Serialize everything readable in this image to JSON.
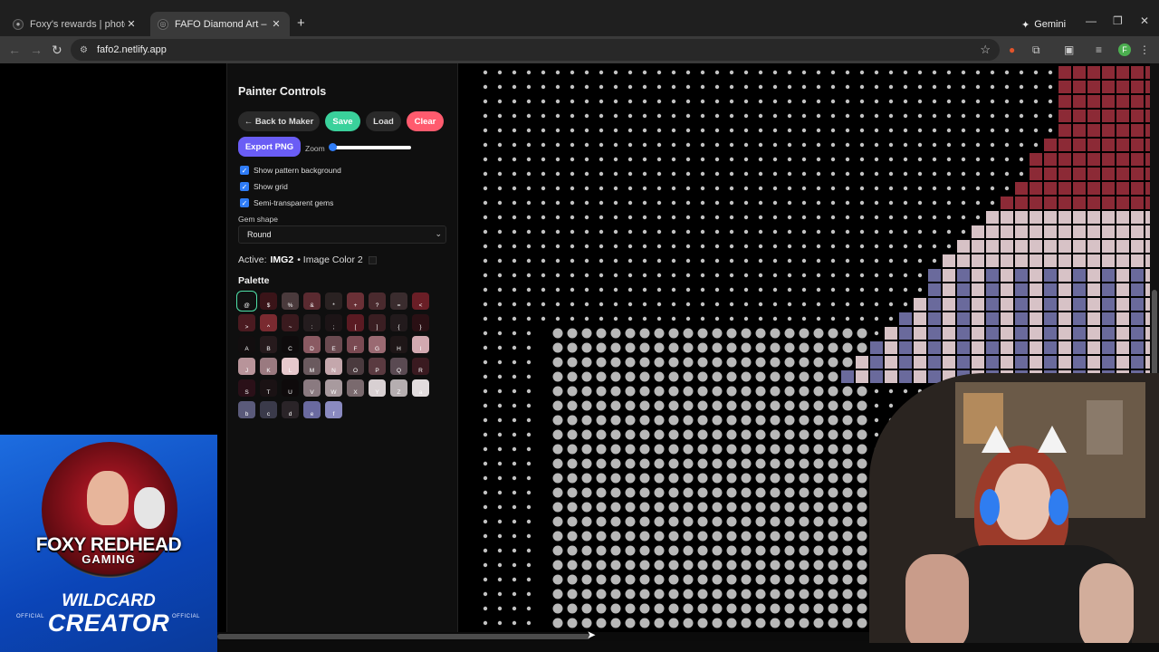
{
  "browser": {
    "tabs": [
      {
        "title": "Foxy's rewards | photos, Goth C",
        "active": false
      },
      {
        "title": "FAFO Diamond Art – Image Col",
        "active": true
      }
    ],
    "new_tab": "+",
    "gemini": "Gemini",
    "url": "fafo2.netlify.app",
    "profile_initial": "F"
  },
  "controls": {
    "title": "Painter Controls",
    "buttons": {
      "back": "← Back to Maker",
      "save": "Save",
      "load": "Load",
      "clear": "Clear",
      "export": "Export PNG"
    },
    "zoom_label": "Zoom",
    "zoom_level": 0,
    "checkboxes": [
      {
        "label": "Show pattern background",
        "checked": true
      },
      {
        "label": "Show grid",
        "checked": true
      },
      {
        "label": "Semi-transparent gems",
        "checked": true
      }
    ],
    "gem_shape_label": "Gem shape",
    "gem_shape_value": "Round",
    "active_prefix": "Active:",
    "active_code": "IMG2",
    "active_name": "• Image Color 2",
    "palette_title": "Palette",
    "palette": [
      {
        "sym": "@",
        "color": "#111111",
        "selected": true
      },
      {
        "sym": "$",
        "color": "#3a1418"
      },
      {
        "sym": "%",
        "color": "#4a3a3c"
      },
      {
        "sym": "&",
        "color": "#5a2a30"
      },
      {
        "sym": "*",
        "color": "#2a2222"
      },
      {
        "sym": "+",
        "color": "#6a3036"
      },
      {
        "sym": "?",
        "color": "#4a2a2e"
      },
      {
        "sym": "=",
        "color": "#3a2c2e"
      },
      {
        "sym": "<",
        "color": "#6a1e26"
      },
      {
        "sym": ">",
        "color": "#4a1a20"
      },
      {
        "sym": "^",
        "color": "#7a2a30"
      },
      {
        "sym": "~",
        "color": "#3a1a1e"
      },
      {
        "sym": ":",
        "color": "#241c1e"
      },
      {
        "sym": ";",
        "color": "#1c1416"
      },
      {
        "sym": "[",
        "color": "#5a1a22"
      },
      {
        "sym": "]",
        "color": "#3a1e22"
      },
      {
        "sym": "{",
        "color": "#221a1c"
      },
      {
        "sym": "}",
        "color": "#2a1014"
      },
      {
        "sym": "A",
        "color": "#120e0f"
      },
      {
        "sym": "B",
        "color": "#261a1c"
      },
      {
        "sym": "C",
        "color": "#0e0b0c"
      },
      {
        "sym": "D",
        "color": "#8a5a62"
      },
      {
        "sym": "E",
        "color": "#6a4a50"
      },
      {
        "sym": "F",
        "color": "#7a4a52"
      },
      {
        "sym": "G",
        "color": "#9a6a72"
      },
      {
        "sym": "H",
        "color": "#1e1617"
      },
      {
        "sym": "I",
        "color": "#d2a9b0"
      },
      {
        "sym": "J",
        "color": "#b8949a"
      },
      {
        "sym": "K",
        "color": "#9a7a80"
      },
      {
        "sym": "L",
        "color": "#e6c9cd"
      },
      {
        "sym": "M",
        "color": "#6a5a5e"
      },
      {
        "sym": "N",
        "color": "#c4a7ac"
      },
      {
        "sym": "O",
        "color": "#4a3a3e"
      },
      {
        "sym": "P",
        "color": "#5a3a40"
      },
      {
        "sym": "Q",
        "color": "#5a4a52"
      },
      {
        "sym": "R",
        "color": "#3a1a20"
      },
      {
        "sym": "S",
        "color": "#2a1018"
      },
      {
        "sym": "T",
        "color": "#1a1214"
      },
      {
        "sym": "U",
        "color": "#0e0a0b"
      },
      {
        "sym": "V",
        "color": "#8a7a80"
      },
      {
        "sym": "W",
        "color": "#a89a9e"
      },
      {
        "sym": "X",
        "color": "#7a6a6e"
      },
      {
        "sym": "Y",
        "color": "#d8d0d2"
      },
      {
        "sym": "Z",
        "color": "#b5aeb0"
      },
      {
        "sym": "a",
        "color": "#e2dcdd"
      },
      {
        "sym": "b",
        "color": "#5a5a7a"
      },
      {
        "sym": "c",
        "color": "#3a3a4a"
      },
      {
        "sym": "d",
        "color": "#2a2428"
      },
      {
        "sym": "e",
        "color": "#6a6aa0"
      },
      {
        "sym": "f",
        "color": "#8a8ac0"
      }
    ]
  },
  "canvas": {
    "bead_color": "#d8d8d8",
    "grid_symbol": "@",
    "side_symbols": ">",
    "legend_colors": {
      "red": "#8c2a36",
      "pink": "#d7c2c6",
      "blue": "#6a6a9c"
    }
  },
  "overlay": {
    "logo": {
      "name_line1": "FOXY REDHEAD",
      "name_line2": "GAMING",
      "wild_line1": "WILDCARD",
      "wild_line2": "CREATOR",
      "official_left": "OFFICIAL",
      "official_right": "OFFICIAL"
    }
  }
}
